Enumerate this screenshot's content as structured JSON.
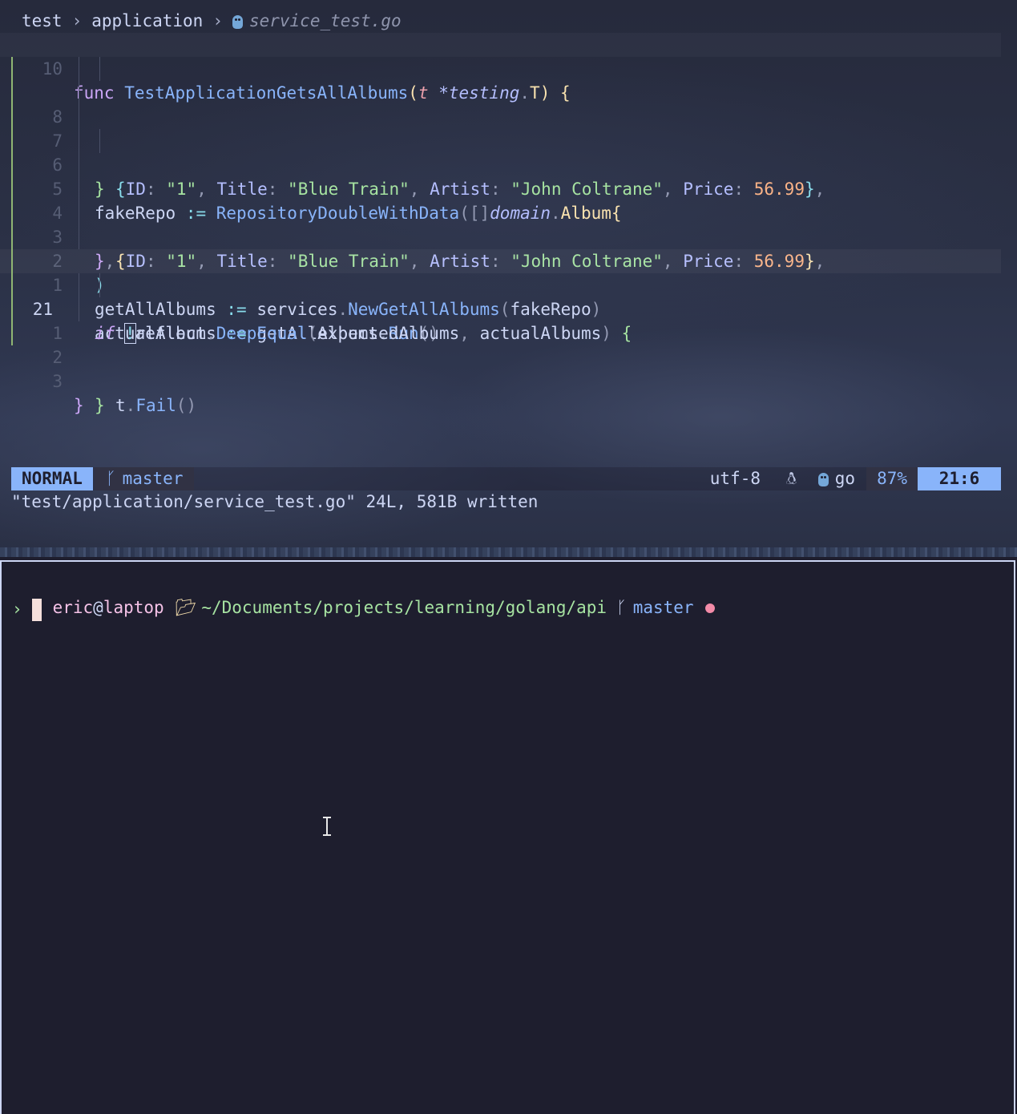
{
  "breadcrumb": {
    "segments": [
      "test",
      "application"
    ],
    "separator": "›",
    "file": "service_test.go",
    "file_icon": "gopher-icon"
  },
  "editor": {
    "lines": [
      {
        "number": "10",
        "tokens": [
          "func",
          "TestApplicationGetsAllAlbums",
          "(",
          "t",
          "*testing",
          ".",
          "T",
          ")",
          "{"
        ]
      },
      {
        "number": "8",
        "tokens": [
          "{",
          "ID",
          ":",
          "\"1\"",
          ",",
          "Title",
          ":",
          "\"Blue Train\"",
          ",",
          "Artist",
          ":",
          "\"John Coltrane\"",
          ",",
          "Price",
          ":",
          "56.99",
          "}",
          ","
        ]
      },
      {
        "number": "7",
        "tokens": [
          "}"
        ]
      },
      {
        "number": "6",
        "tokens": [
          "fakeRepo",
          ":=",
          "RepositoryDoubleWithData",
          "(",
          "[]",
          "domain",
          ".",
          "Album",
          "{"
        ]
      },
      {
        "number": "5",
        "tokens": [
          "{",
          "ID",
          ":",
          "\"1\"",
          ",",
          "Title",
          ":",
          "\"Blue Train\"",
          ",",
          "Artist",
          ":",
          "\"John Coltrane\"",
          ",",
          "Price",
          ":",
          "56.99",
          "}",
          ","
        ]
      },
      {
        "number": "4",
        "tokens": [
          "}",
          ","
        ]
      },
      {
        "number": "3",
        "tokens": [
          ")"
        ]
      },
      {
        "number": "2",
        "tokens": [
          "getAllAlbums",
          ":=",
          "services",
          ".",
          "NewGetAllAlbums",
          "(",
          "fakeRepo",
          ")"
        ]
      },
      {
        "number": "1",
        "tokens": [
          "actualAlbums",
          ":=",
          "getAllAlbums",
          ".",
          "Run",
          "()"
        ]
      },
      {
        "number": "21",
        "tokens": [
          "if",
          "!",
          "reflect",
          ".",
          "DeepEqual",
          "(",
          "expectedAlbums",
          ",",
          "actualAlbums",
          ")",
          "{"
        ]
      },
      {
        "number": "1",
        "tokens": [
          "t",
          ".",
          "Fail",
          "()"
        ]
      },
      {
        "number": "2",
        "tokens": [
          "}"
        ]
      },
      {
        "number": "3",
        "tokens": [
          "}"
        ]
      }
    ]
  },
  "statusline": {
    "mode": "NORMAL",
    "branch_icon": "git-branch-icon",
    "branch": "master",
    "encoding": "utf-8",
    "os_icon": "linux-penguin-icon",
    "filetype_icon": "gopher-icon",
    "filetype": "go",
    "percent": "87%",
    "position": "21:6"
  },
  "message": "\"test/application/service_test.go\" 24L, 581B written",
  "terminal": {
    "user": "eric",
    "at": "@",
    "host": "laptop",
    "folder_icon": "open-folder-icon",
    "path": "~/Documents/projects/learning/golang/api",
    "branch_icon": "git-branch-icon",
    "branch": "master",
    "dirty_color": "#f38ba8",
    "prompt_char": "›"
  }
}
